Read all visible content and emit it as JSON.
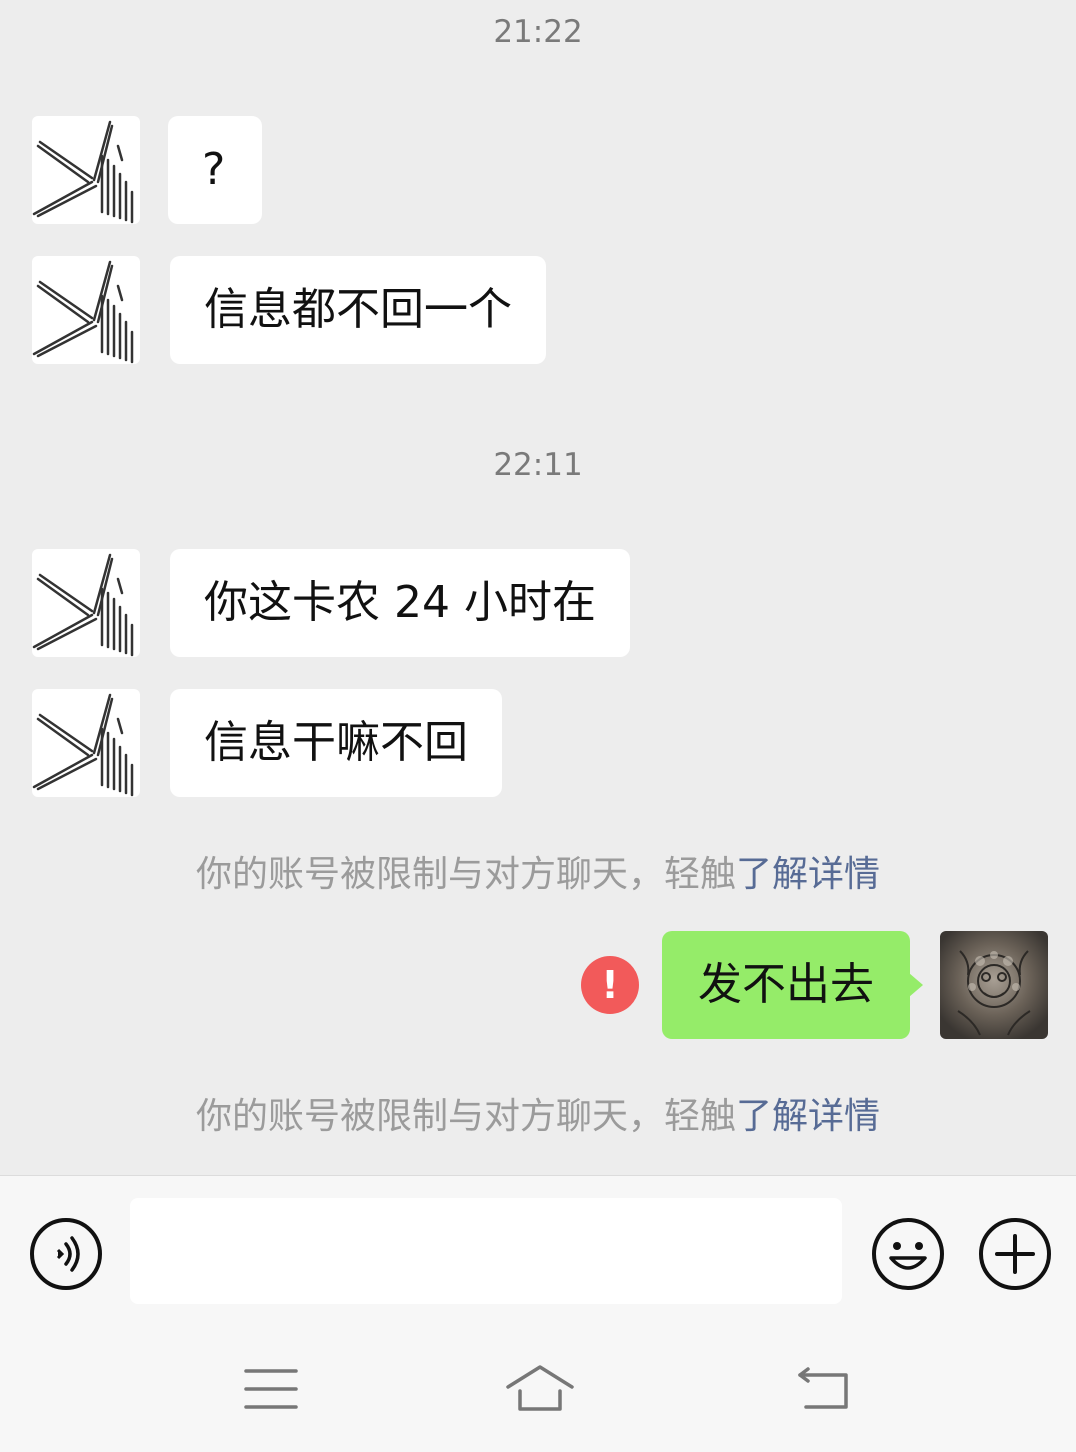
{
  "chat": {
    "timestamps": [
      "21:22",
      "22:11"
    ],
    "messages": [
      {
        "text": "?"
      },
      {
        "text": "信息都不回一个"
      },
      {
        "text": "你这卡农 24 小时在"
      },
      {
        "text": "信息干嘛不回"
      }
    ],
    "notice": {
      "text": "你的账号被限制与对方聊天，轻触",
      "link": "了解详情"
    },
    "sent_message": {
      "text": "发不出去",
      "error_mark": "!"
    }
  },
  "input_bar": {
    "icons": [
      "voice-icon",
      "emoji-icon",
      "plus-icon"
    ]
  },
  "nav_bar": {
    "icons": [
      "menu-icon",
      "home-icon",
      "back-icon"
    ]
  },
  "colors": {
    "background": "#ededed",
    "sent_bubble": "#95ec69",
    "link": "#576b95",
    "error": "#f25a5a"
  }
}
